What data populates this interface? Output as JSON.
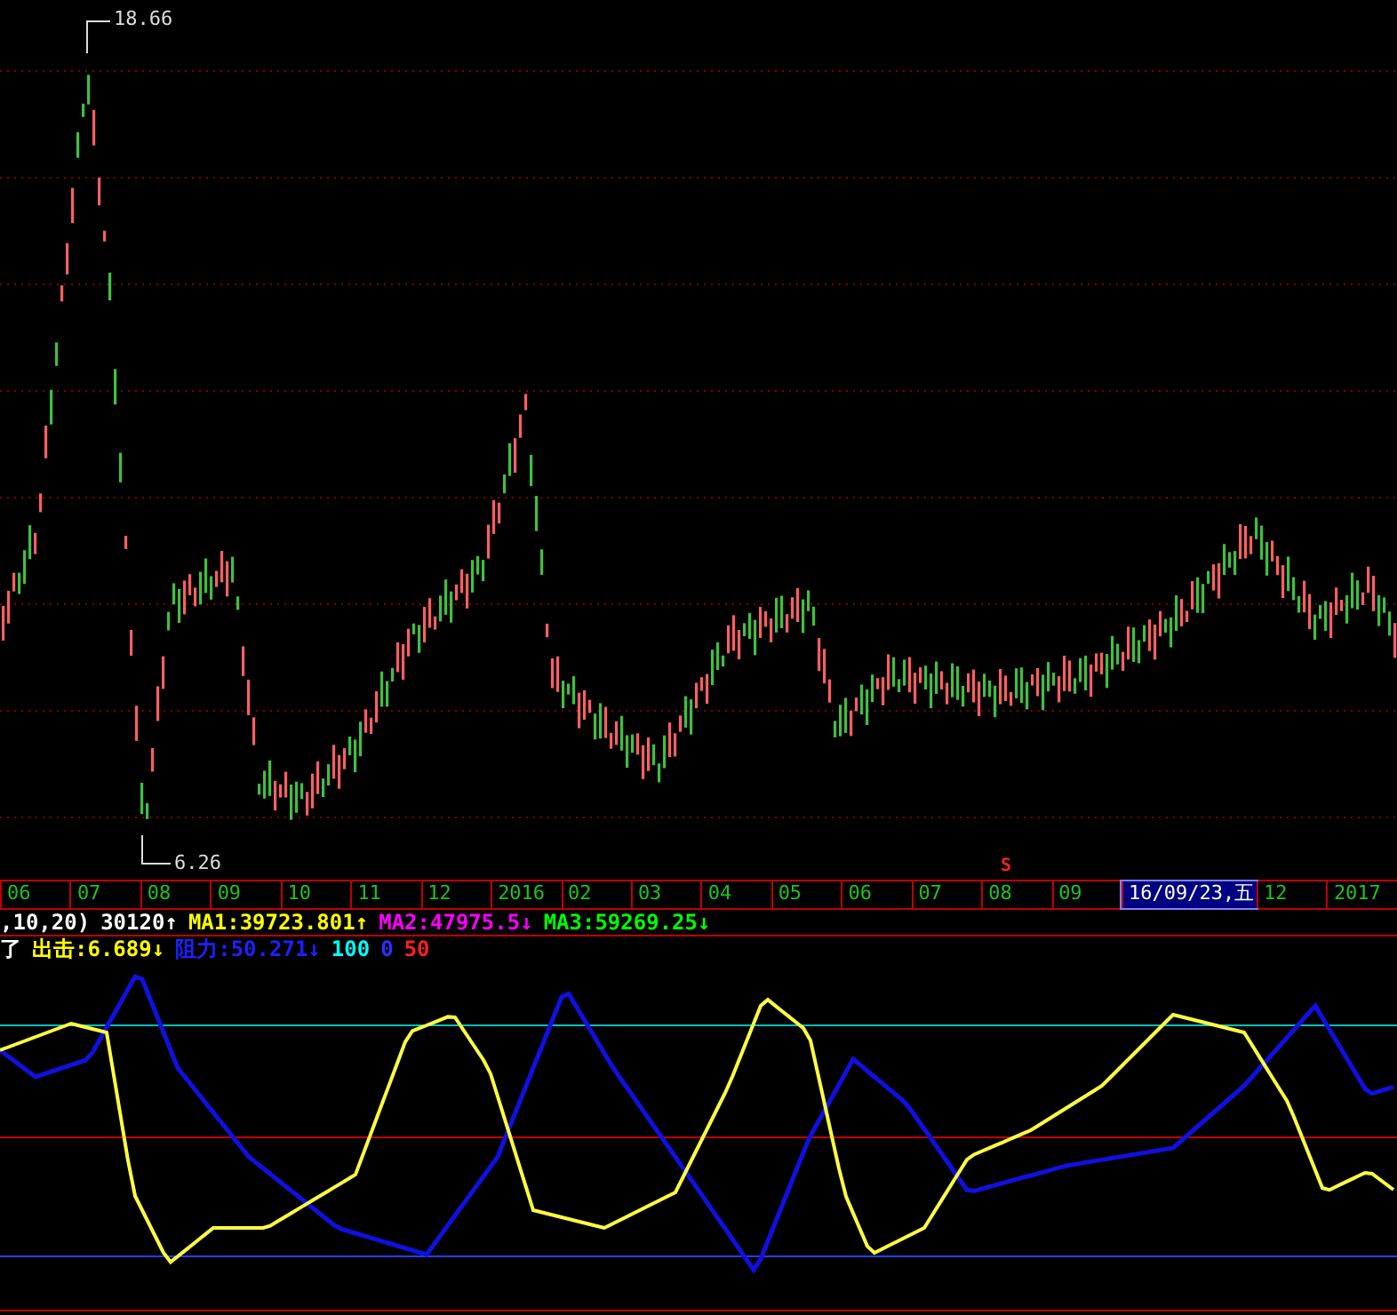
{
  "price_chart": {
    "high_label": "18.66",
    "low_label": "6.26",
    "signal_marker": "S"
  },
  "time_axis": [
    {
      "label": "06",
      "selected": false
    },
    {
      "label": "07",
      "selected": false
    },
    {
      "label": "08",
      "selected": false
    },
    {
      "label": "09",
      "selected": false
    },
    {
      "label": "10",
      "selected": false
    },
    {
      "label": "11",
      "selected": false
    },
    {
      "label": "12",
      "selected": false
    },
    {
      "label": "2016",
      "selected": false
    },
    {
      "label": "02",
      "selected": false
    },
    {
      "label": "03",
      "selected": false
    },
    {
      "label": "04",
      "selected": false
    },
    {
      "label": "05",
      "selected": false
    },
    {
      "label": "06",
      "selected": false
    },
    {
      "label": "07",
      "selected": false
    },
    {
      "label": "08",
      "selected": false
    },
    {
      "label": "09",
      "selected": false
    },
    {
      "label": "16/09/23,五",
      "selected": true
    },
    {
      "label": "12",
      "selected": false
    },
    {
      "label": "2017",
      "selected": false
    }
  ],
  "volume_legend": [
    {
      "text": ",10,20)",
      "color": "#ffffff"
    },
    {
      "text": "30120",
      "arrow": "↑",
      "color": "#ffffff"
    },
    {
      "text": "MA1:39723.801",
      "arrow": "↑",
      "color": "#ffff00"
    },
    {
      "text": "MA2:47975.5",
      "arrow": "↓",
      "color": "#ff00ff"
    },
    {
      "text": "MA3:59269.25",
      "arrow": "↓",
      "color": "#00ff00"
    }
  ],
  "indicator_legend": [
    {
      "text": "了",
      "color": "#ffffff"
    },
    {
      "text": "出击:6.689",
      "arrow": "↓",
      "color": "#ffff00"
    },
    {
      "text": "阻力:50.271",
      "arrow": "↓",
      "color": "#2020ff"
    },
    {
      "text": "100",
      "color": "#00ffff"
    },
    {
      "text": "0",
      "color": "#3030ff"
    },
    {
      "text": "50",
      "color": "#ff2020"
    }
  ]
}
